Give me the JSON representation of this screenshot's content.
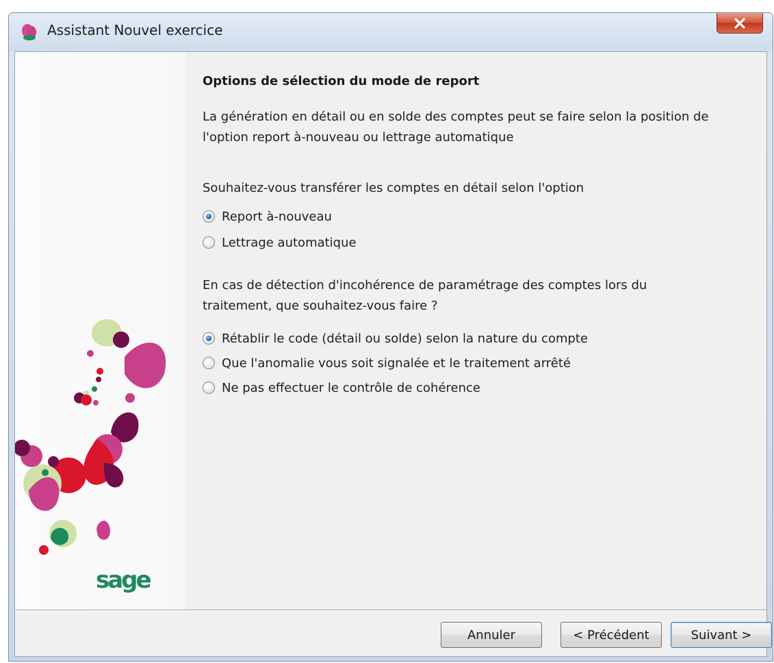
{
  "window": {
    "title": "Assistant Nouvel exercice"
  },
  "content": {
    "heading": "Options de sélection du mode de report",
    "intro_line1": "La génération en détail ou en solde des comptes peut se faire selon la position de",
    "intro_line2": "l'option report à-nouveau ou lettrage automatique",
    "question1": "Souhaitez-vous transférer les comptes en détail selon l'option",
    "option_group1": [
      {
        "label": "Report à-nouveau",
        "checked": true
      },
      {
        "label": "Lettrage automatique",
        "checked": false
      }
    ],
    "question2_line1": "En cas de détection d'incohérence de paramétrage des comptes lors du",
    "question2_line2": "traitement, que souhaitez-vous faire ?",
    "option_group2": [
      {
        "label": "Rétablir le code (détail ou solde) selon la nature du compte",
        "checked": true
      },
      {
        "label": "Que l'anomalie vous soit signalée et le traitement arrêté",
        "checked": false
      },
      {
        "label": "Ne pas effectuer le contrôle de cohérence",
        "checked": false
      }
    ]
  },
  "buttons": {
    "cancel": "Annuler",
    "previous": "< Précédent",
    "next": "Suivant >"
  },
  "brand": {
    "logo_text": "sage",
    "logo_color": "#1f8a5a"
  },
  "colors": {
    "magenta": "#c8408a",
    "plum": "#6e0f4a",
    "red": "#d9162b",
    "light_green": "#cfe0a8",
    "green": "#1b8a5c"
  }
}
